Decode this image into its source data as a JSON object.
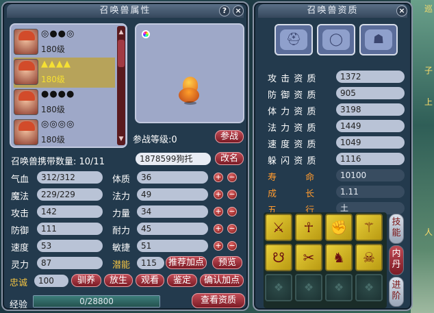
{
  "left_window": {
    "title": "召唤兽属性",
    "help_label": "?",
    "close_label": "×",
    "pets": [
      {
        "stars": "◎●●◎",
        "level": "180级",
        "selected": false
      },
      {
        "stars": "▲▲▲▲",
        "level": "180级",
        "selected": true
      },
      {
        "stars": "●●●●",
        "level": "180级",
        "selected": false
      },
      {
        "stars": "◎◎◎◎",
        "level": "180级",
        "selected": false
      }
    ],
    "battle_level_label": "参战等级:0",
    "battle_button": "参战",
    "carry_label": "召唤兽携带数量: 10/11",
    "pet_name": "1878599狗托",
    "rename_button": "改名",
    "stats_left": [
      {
        "label": "气血",
        "value": "312/312"
      },
      {
        "label": "魔法",
        "value": "229/229"
      },
      {
        "label": "攻击",
        "value": "142"
      },
      {
        "label": "防御",
        "value": "111"
      },
      {
        "label": "速度",
        "value": "53"
      },
      {
        "label": "灵力",
        "value": "87"
      }
    ],
    "stats_right": [
      {
        "label": "体质",
        "value": "36"
      },
      {
        "label": "法力",
        "value": "49"
      },
      {
        "label": "力量",
        "value": "34"
      },
      {
        "label": "耐力",
        "value": "45"
      },
      {
        "label": "敏捷",
        "value": "51"
      }
    ],
    "potential_label": "潜能",
    "potential_value": "115",
    "recommend_button": "推荐加点",
    "preview_button": "预览",
    "loyalty_label": "忠诚",
    "loyalty_value": "100",
    "tame_button": "驯养",
    "release_button": "放生",
    "watch_button": "观看",
    "appraise_button": "鉴定",
    "confirm_button": "确认加点",
    "exp_label": "经验",
    "exp_value": "0/28800",
    "view_aptitude_button": "查看资质"
  },
  "right_window": {
    "title": "召唤兽资质",
    "close_label": "×",
    "equip_icons": [
      "helmet-icon",
      "necklace-icon",
      "armor-icon"
    ],
    "aptitudes": [
      {
        "label": "攻 击 资 质",
        "value": "1372"
      },
      {
        "label": "防 御 资 质",
        "value": "905"
      },
      {
        "label": "体 力 资 质",
        "value": "3198"
      },
      {
        "label": "法 力 资 质",
        "value": "1449"
      },
      {
        "label": "速 度 资 质",
        "value": "1049"
      },
      {
        "label": "躲 闪 资 质",
        "value": "1116"
      }
    ],
    "life_label": "寿 命",
    "life_value": "10100",
    "growth_label": "成 长",
    "growth_value": "1.11",
    "element_label": "五 行",
    "element_value": "土",
    "skills_tab": "技能",
    "neidan_tab": "内丹",
    "advance_tab": "进阶",
    "skill_glyphs": [
      "⚔",
      "☥",
      "✊",
      "⚚",
      "☋",
      "✂",
      "♞",
      "☠"
    ],
    "empty_glyph": "❖"
  },
  "background": {
    "side_text": [
      "巡",
      "子",
      "上",
      "人"
    ]
  }
}
